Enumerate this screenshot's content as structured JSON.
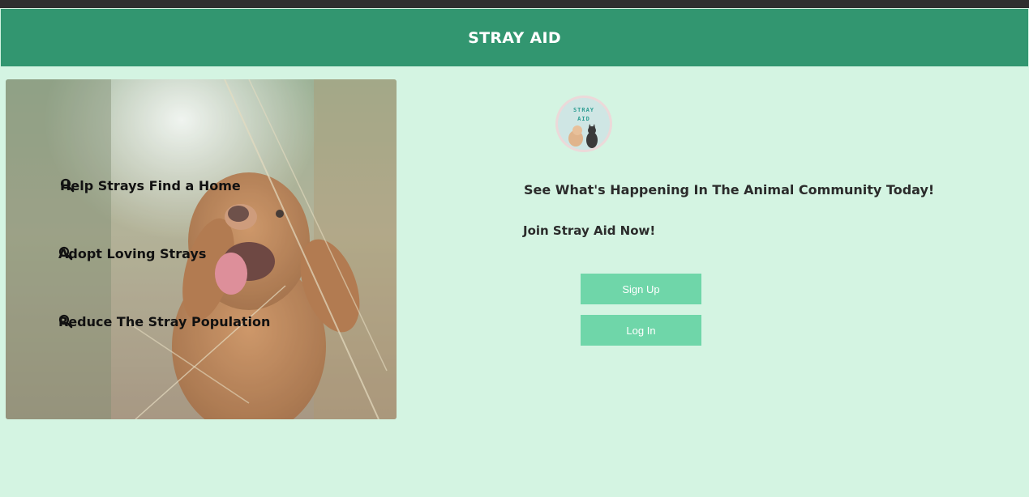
{
  "header": {
    "title": "STRAY AID"
  },
  "features": [
    {
      "label": "Help Strays Find a Home",
      "icon": "search-icon"
    },
    {
      "label": "Adopt Loving Strays",
      "icon": "search-icon"
    },
    {
      "label": "Reduce The Stray Population",
      "icon": "search-icon"
    }
  ],
  "logo": {
    "line1": "STRAY",
    "line2": "AID"
  },
  "main": {
    "tagline": "See What's Happening In The Animal Community Today!",
    "join": "Join Stray Aid Now!"
  },
  "buttons": {
    "signup": "Sign Up",
    "login": "Log In"
  },
  "colors": {
    "header": "#329670",
    "background": "#d4f4e2",
    "button": "#6fd6a9"
  }
}
